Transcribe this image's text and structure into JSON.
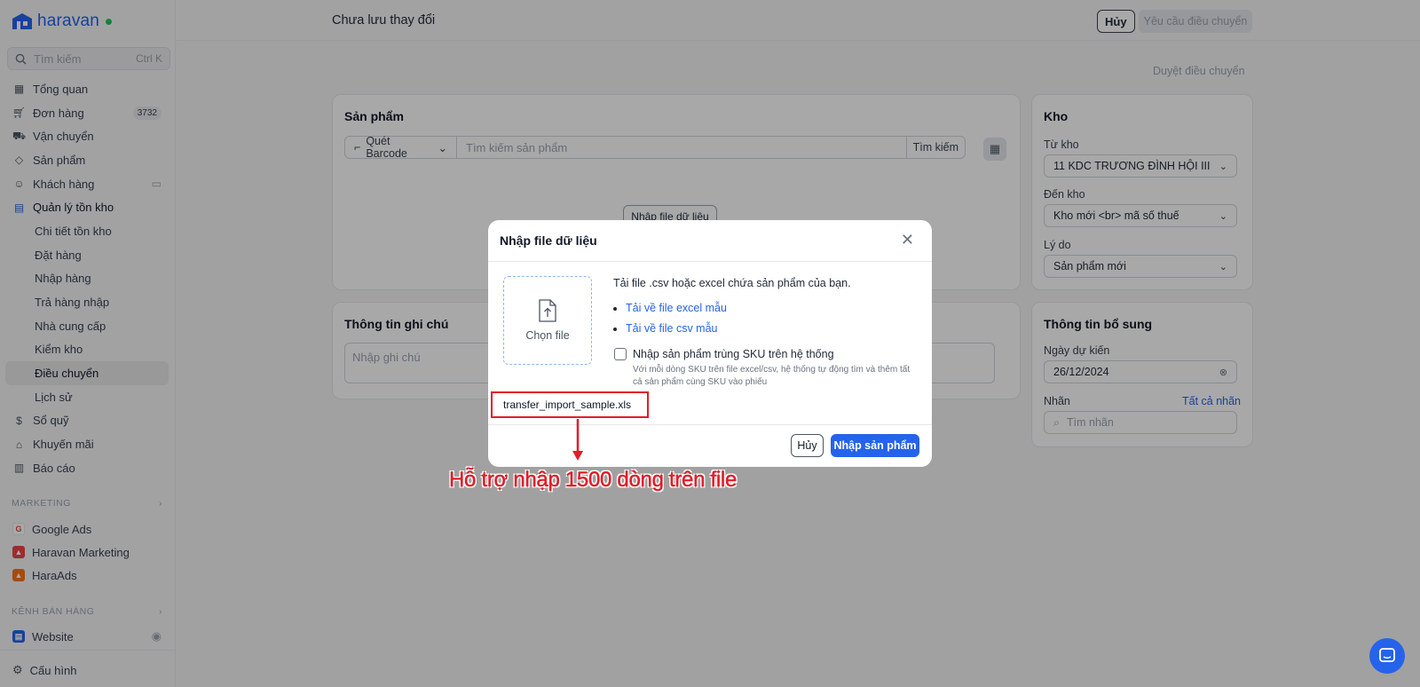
{
  "brand": {
    "name": "haravan",
    "accent": "#2563eb"
  },
  "sidebar": {
    "search": {
      "placeholder": "Tìm kiếm",
      "shortcut": "Ctrl K"
    },
    "items": [
      {
        "label": "Tổng quan",
        "icon": "dashboard-icon"
      },
      {
        "label": "Đơn hàng",
        "icon": "cart-icon",
        "badge": "3732"
      },
      {
        "label": "Vận chuyển",
        "icon": "truck-icon"
      },
      {
        "label": "Sản phẩm",
        "icon": "tag-icon"
      },
      {
        "label": "Khách hàng",
        "icon": "users-icon"
      },
      {
        "label": "Quản lý tồn kho",
        "icon": "inventory-icon"
      },
      {
        "label": "Chi tiết tồn kho"
      },
      {
        "label": "Đặt hàng"
      },
      {
        "label": "Nhập hàng"
      },
      {
        "label": "Trả hàng nhập"
      },
      {
        "label": "Nhà cung cấp"
      },
      {
        "label": "Kiểm kho"
      },
      {
        "label": "Điều chuyển"
      },
      {
        "label": "Lịch sử"
      },
      {
        "label": "Sổ quỹ",
        "icon": "cash-icon"
      },
      {
        "label": "Khuyến mãi",
        "icon": "gift-icon"
      },
      {
        "label": "Báo cáo",
        "icon": "report-icon"
      }
    ],
    "marketing_label": "MARKETING",
    "marketing": [
      {
        "label": "Google Ads"
      },
      {
        "label": "Haravan Marketing"
      },
      {
        "label": "HaraAds"
      }
    ],
    "channels_label": "KÊNH BÁN HÀNG",
    "channels": [
      {
        "label": "Website"
      }
    ],
    "settings_label": "Cấu hình"
  },
  "topbar": {
    "title": "Chưa lưu thay đổi",
    "cancel_label": "Hủy",
    "request_label": "Yêu cầu điều chuyển"
  },
  "page": {
    "approve_label": "Duyệt điều chuyển",
    "products": {
      "title": "Sản phẩm",
      "barcode_label": "Quét Barcode",
      "search_placeholder": "Tìm kiếm sản phẩm",
      "search_button": "Tìm kiếm",
      "import_button": "Nhập file dữ liệu"
    },
    "note": {
      "title": "Thông tin ghi chú",
      "placeholder": "Nhập ghi chú"
    },
    "warehouse": {
      "title": "Kho",
      "from_label": "Từ kho",
      "from_value": "11 KDC TRƯƠNG ĐÌNH HỘI III",
      "to_label": "Đến kho",
      "to_value": "Kho mới <br> mã số thuế",
      "reason_label": "Lý do",
      "reason_value": "Sản phẩm mới"
    },
    "extra": {
      "title": "Thông tin bổ sung",
      "date_label": "Ngày dự kiến",
      "date_value": "26/12/2024",
      "tag_label": "Nhãn",
      "all_tags": "Tất cả nhãn",
      "tag_placeholder": "Tìm nhãn"
    }
  },
  "modal": {
    "title": "Nhập file dữ liệu",
    "choose_file": "Chọn file",
    "description": "Tải file .csv hoặc excel chứa sản phẩm của bạn.",
    "link_excel": "Tải về file excel mẫu",
    "link_csv": "Tải về file csv mẫu",
    "checkbox_label": "Nhập sản phẩm trùng SKU trên hệ thống",
    "checkbox_help": "Với mỗi dòng SKU trên file excel/csv, hệ thống tự động tìm và thêm tất cả sản phẩm cùng SKU vào phiếu",
    "filename": "transfer_import_sample.xls",
    "cancel_label": "Hủy",
    "submit_label": "Nhập sản phẩm"
  },
  "annotation": {
    "text": "Hỗ trợ nhập 1500 dòng trên file",
    "color": "#e11d2a"
  }
}
